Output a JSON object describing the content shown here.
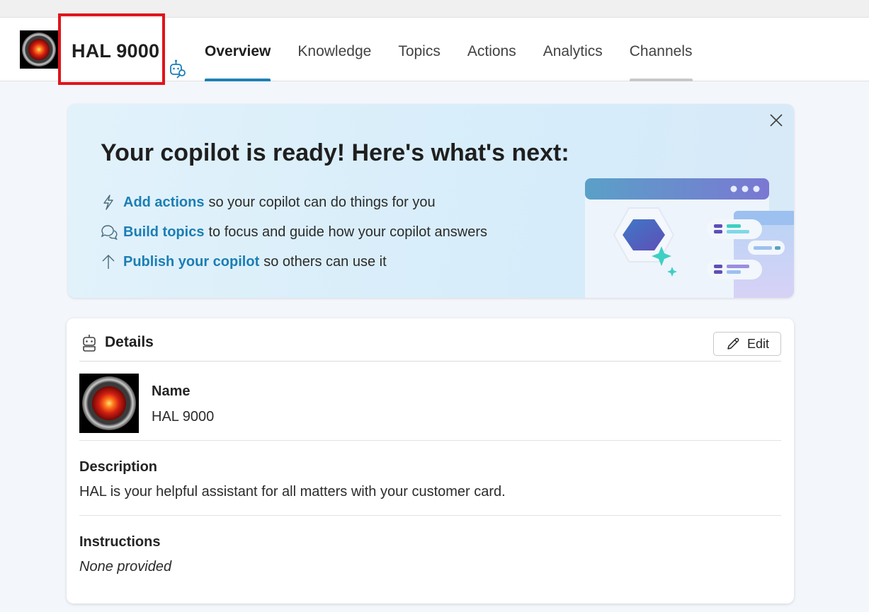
{
  "app": {
    "title": "HAL 9000",
    "avatar_icon": "hal-9000-avatar"
  },
  "tabs": [
    {
      "label": "Overview",
      "active": true
    },
    {
      "label": "Knowledge",
      "active": false
    },
    {
      "label": "Topics",
      "active": false
    },
    {
      "label": "Actions",
      "active": false
    },
    {
      "label": "Analytics",
      "active": false
    },
    {
      "label": "Channels",
      "active": false
    }
  ],
  "banner": {
    "title": "Your copilot is ready! Here's what's next:",
    "items": [
      {
        "icon": "lightning-icon",
        "link": "Add actions",
        "text": "so your copilot can do things for you"
      },
      {
        "icon": "chat-bubbles-icon",
        "link": "Build topics",
        "text": "to focus and guide how your copilot answers"
      },
      {
        "icon": "arrow-up-icon",
        "link": "Publish your copilot",
        "text": "so others can use it"
      }
    ],
    "close_icon": "close-icon"
  },
  "details": {
    "title": "Details",
    "edit_label": "Edit",
    "name_label": "Name",
    "name_value": "HAL 9000",
    "description_label": "Description",
    "description_value": "HAL is your helpful assistant for all matters with your customer card.",
    "instructions_label": "Instructions",
    "instructions_value": "None provided"
  },
  "colors": {
    "accent": "#1b7eb4",
    "highlight_box": "#e0141a",
    "banner_bg": "#dcefFa"
  }
}
